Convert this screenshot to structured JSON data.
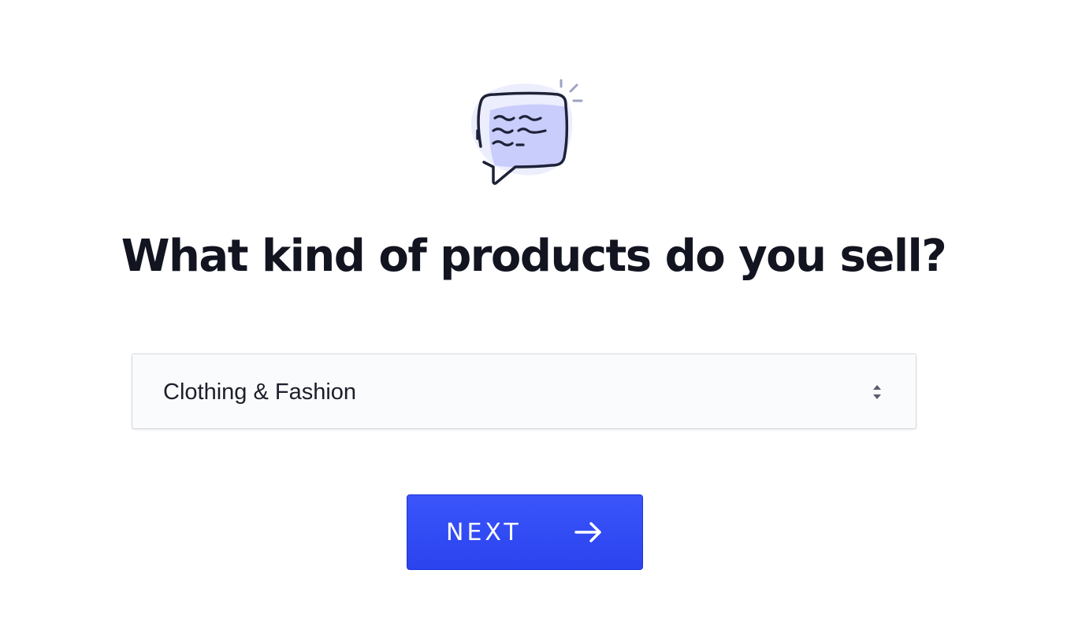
{
  "onboarding": {
    "question": "What kind of products do you sell?",
    "product_select": {
      "selected_value": "Clothing & Fashion"
    },
    "next_button": {
      "label": "NEXT"
    }
  },
  "icons": {
    "illustration": "chat-bubble-icon",
    "select_arrows": "chevron-up-down-icon",
    "next_arrow": "arrow-right-icon"
  },
  "colors": {
    "primary_button": "#2f49f5",
    "heading_text": "#121420",
    "illustration_fill": "#c9cdfb",
    "illustration_stroke": "#1e2238"
  }
}
